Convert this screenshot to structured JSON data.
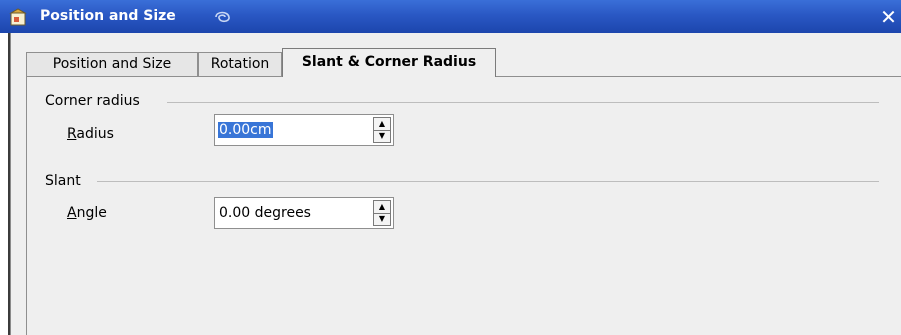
{
  "window": {
    "title": "Position and Size",
    "close_glyph": "✕"
  },
  "tabs": [
    {
      "label": "Position and Size",
      "active": false
    },
    {
      "label": "Rotation",
      "active": false
    },
    {
      "label": "Slant & Corner Radius",
      "active": true
    }
  ],
  "corner_radius": {
    "section_label": "Corner radius",
    "radius_label_mnemonic": "R",
    "radius_label_rest": "adius",
    "radius_value": "0.00cm"
  },
  "slant": {
    "section_label": "Slant",
    "angle_label_mnemonic": "A",
    "angle_label_rest": "ngle",
    "angle_value": "0.00 degrees"
  },
  "colors": {
    "titlebar": "#2a58c4",
    "selection": "#3875d7",
    "dialog_bg": "#efefef"
  },
  "icons": {
    "app": "window-app-icon",
    "title_decoration": "swirl-icon",
    "close": "close-icon",
    "spin_up": "arrow-up-icon",
    "spin_down": "arrow-down-icon"
  }
}
